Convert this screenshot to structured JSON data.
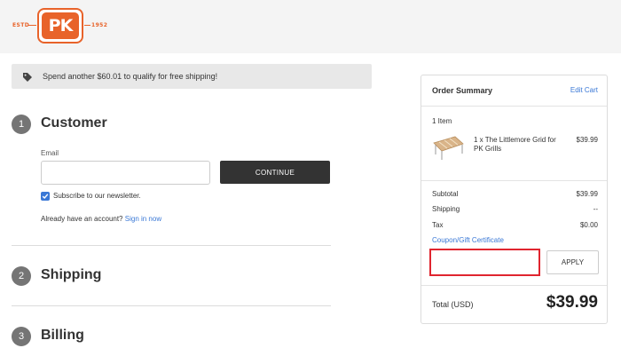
{
  "header": {
    "logo_text": "PK",
    "logo_est": "ESTD",
    "logo_year": "1952"
  },
  "banner": {
    "icon": "tag-icon",
    "text": "Spend another $60.01 to qualify for free shipping!"
  },
  "steps": [
    {
      "number": "1",
      "title": "Customer"
    },
    {
      "number": "2",
      "title": "Shipping"
    },
    {
      "number": "3",
      "title": "Billing"
    }
  ],
  "customer": {
    "email_label": "Email",
    "email_value": "",
    "continue_label": "CONTINUE",
    "newsletter_label": "Subscribe to our newsletter.",
    "newsletter_checked": true,
    "account_prompt": "Already have an account?",
    "signin_label": "Sign in now"
  },
  "summary": {
    "title": "Order Summary",
    "edit_cart_label": "Edit Cart",
    "item_count": "1 Item",
    "item": {
      "name": "1 x The Littlemore Grid for PK Grills",
      "price": "$39.99"
    },
    "rows": [
      {
        "label": "Subtotal",
        "value": "$39.99"
      },
      {
        "label": "Shipping",
        "value": "--"
      },
      {
        "label": "Tax",
        "value": "$0.00"
      }
    ],
    "coupon_label": "Coupon/Gift Certificate",
    "coupon_value": "",
    "apply_label": "APPLY",
    "total_label": "Total (USD)",
    "total_value": "$39.99"
  },
  "colors": {
    "brand_orange": "#e8632a",
    "link_blue": "#3a78d6",
    "highlight_red": "#e0252f",
    "button_dark": "#333333"
  }
}
